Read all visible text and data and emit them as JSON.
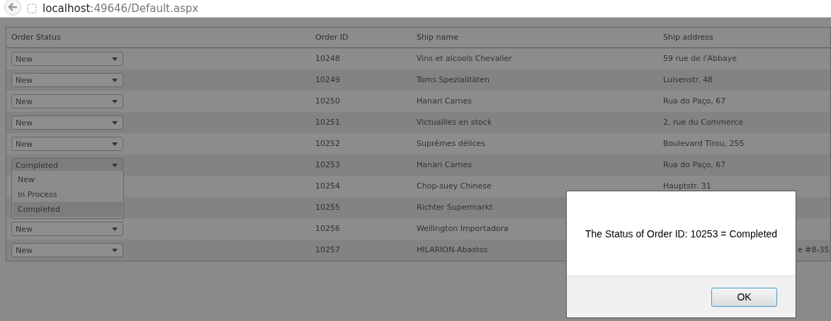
{
  "browser": {
    "url_host": "localhost",
    "url_rest": ":49646/Default.aspx"
  },
  "table": {
    "columns": [
      "Order Status",
      "Order ID",
      "Ship name",
      "Ship address"
    ],
    "rows": [
      {
        "status": "New",
        "expanded": false,
        "order_id": "10248",
        "ship_name": "Vins et alcools Chevalier",
        "ship_address": "59 rue de l'Abbaye"
      },
      {
        "status": "New",
        "expanded": false,
        "order_id": "10249",
        "ship_name": "Toms Spezialitäten",
        "ship_address": "Luisenstr. 48"
      },
      {
        "status": "New",
        "expanded": false,
        "order_id": "10250",
        "ship_name": "Hanari Carnes",
        "ship_address": "Rua do Paço, 67"
      },
      {
        "status": "New",
        "expanded": false,
        "order_id": "10251",
        "ship_name": "Victuailles en stock",
        "ship_address": "2, rue du Commerce"
      },
      {
        "status": "New",
        "expanded": false,
        "order_id": "10252",
        "ship_name": "Suprêmes délices",
        "ship_address": "Boulevard Tirou, 255"
      },
      {
        "status": "Completed",
        "expanded": true,
        "order_id": "10253",
        "ship_name": "Hanari Carnes",
        "ship_address": "Rua do Paço, 67"
      },
      {
        "order_id": "10254",
        "ship_name": "Chop-suey Chinese",
        "ship_address": "Hauptstr. 31"
      },
      {
        "order_id": "10255",
        "ship_name": "Richter Supermarkt"
      },
      {
        "status": "New",
        "expanded": false,
        "order_id": "10256",
        "ship_name": "Wellington Importadora"
      },
      {
        "status": "New",
        "expanded": false,
        "order_id": "10257",
        "ship_name": "HILARION-Abastos",
        "ship_address": "e #8-35",
        "address_cut_left": true
      }
    ],
    "dropdown_options": [
      {
        "label": "New",
        "selected": false
      },
      {
        "label": "In Process",
        "selected": false
      },
      {
        "label": "Completed",
        "selected": true
      }
    ]
  },
  "dialog": {
    "message": "The Status of Order ID: 10253 = Completed",
    "buttons": [
      "OK"
    ]
  }
}
